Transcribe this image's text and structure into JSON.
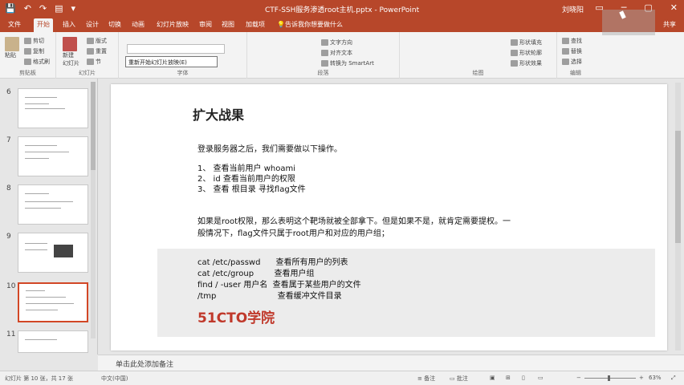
{
  "titlebar": {
    "title": "CTF-SSH服务渗透root主机.pptx - PowerPoint",
    "user": "刘晓阳",
    "qat": [
      "💾",
      "↶",
      "↷",
      "▤",
      "▾"
    ],
    "window_controls": [
      "▭",
      "─",
      "▢",
      "✕"
    ]
  },
  "tabs": {
    "items": [
      "文件",
      "开始",
      "插入",
      "设计",
      "切换",
      "动画",
      "幻灯片放映",
      "审阅",
      "视图",
      "加载项"
    ],
    "active": "开始",
    "tell_me": "告诉我你想要做什么",
    "share": "共享"
  },
  "ribbon": {
    "paste": "粘贴",
    "cut": "剪切",
    "copy": "复制",
    "format_painter": "格式刷",
    "new_slide": "新建\n幻灯片",
    "layout": "版式",
    "reset": "重置",
    "section": "节",
    "tooltip": "重新开始幻灯片放映(E)",
    "find": "查找",
    "replace": "替换",
    "select": "选择",
    "text_direction": "文字方向",
    "align_text": "对齐文本",
    "smartart": "转换为 SmartArt",
    "shape_fill": "形状填充",
    "shape_outline": "形状轮廓",
    "shape_effects": "形状效果",
    "groups": [
      "剪贴板",
      "幻灯片",
      "字体",
      "段落",
      "绘图",
      "编辑"
    ]
  },
  "thumbnails": {
    "numbers": [
      "6",
      "7",
      "8",
      "9",
      "10",
      "11"
    ],
    "selected": "10"
  },
  "slide": {
    "title": "扩大战果",
    "intro": "登录服务器之后，我们需要做以下操作。",
    "steps": [
      "1、 查看当前用户 whoami",
      "2、 id 查看当前用户的权限",
      "3、 查看 根目录 寻找flag文件"
    ],
    "para1": "如果是root权限，那么表明这个靶场就被全部拿下。但是如果不是，就肯定需要提权。一",
    "para2": "般情况下，flag文件只属于root用户和对应的用户组；",
    "commands": [
      "cat /etc/passwd      查看所有用户的列表",
      "cat /etc/group        查看用户组",
      "find / -user 用户名  查看属于某些用户的文件",
      "/tmp                        查看缓冲文件目录"
    ],
    "logo": "51CTO学院"
  },
  "notes": {
    "placeholder": "单击此处添加备注"
  },
  "status": {
    "slide_info": "幻灯片 第 10 张，共 17 张",
    "language": "中文(中国)",
    "notes_btn": "备注",
    "comments_btn": "批注",
    "zoom": "63%"
  }
}
